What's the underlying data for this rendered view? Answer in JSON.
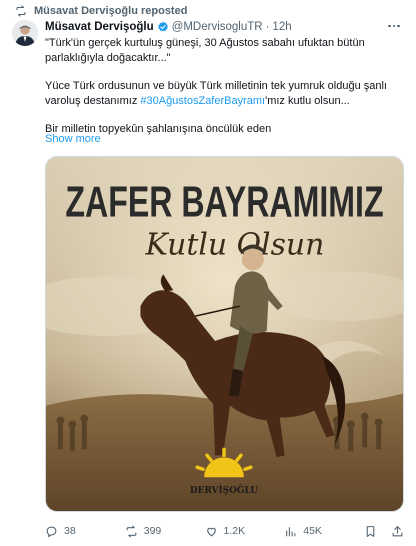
{
  "repost": {
    "text": "Müsavat Dervişoğlu reposted",
    "icon": "repost-icon"
  },
  "tweet": {
    "author": "Müsavat Dervişoğlu",
    "handle": "@MDervisogluTR",
    "separator": "·",
    "time": "12h",
    "text": {
      "p1": "\"Türk'ün gerçek kurtuluş güneşi, 30 Ağustos sabahı ufuktan bütün parlaklığıyla doğacaktır...\"",
      "p2_before": "Yüce Türk ordusunun ve büyük Türk milletinin tek yumruk olduğu şanlı varoluş destanımız ",
      "hashtag": "#30AğustosZaferBayramı",
      "p2_after": "'mız kutlu olsun...",
      "p3": "Bir milletin topyekûn şahlanışına öncülük eden"
    },
    "show_more": "Show more"
  },
  "media": {
    "headline": "ZAFER BAYRAMIMIZ",
    "script_line": "Kutlu Olsun",
    "logo_text": "DERVİŞOĞLU",
    "colors": {
      "sky": "#cdbfa3",
      "ground": "#7b5f3a",
      "horse": "#4a2a17",
      "sun": "#f3c418"
    }
  },
  "actions": {
    "replies": "38",
    "reposts": "399",
    "likes": "1.2K",
    "views": "45K"
  },
  "colors": {
    "accent": "#1d9bf0",
    "text": "#0f1419",
    "muted": "#536471"
  }
}
